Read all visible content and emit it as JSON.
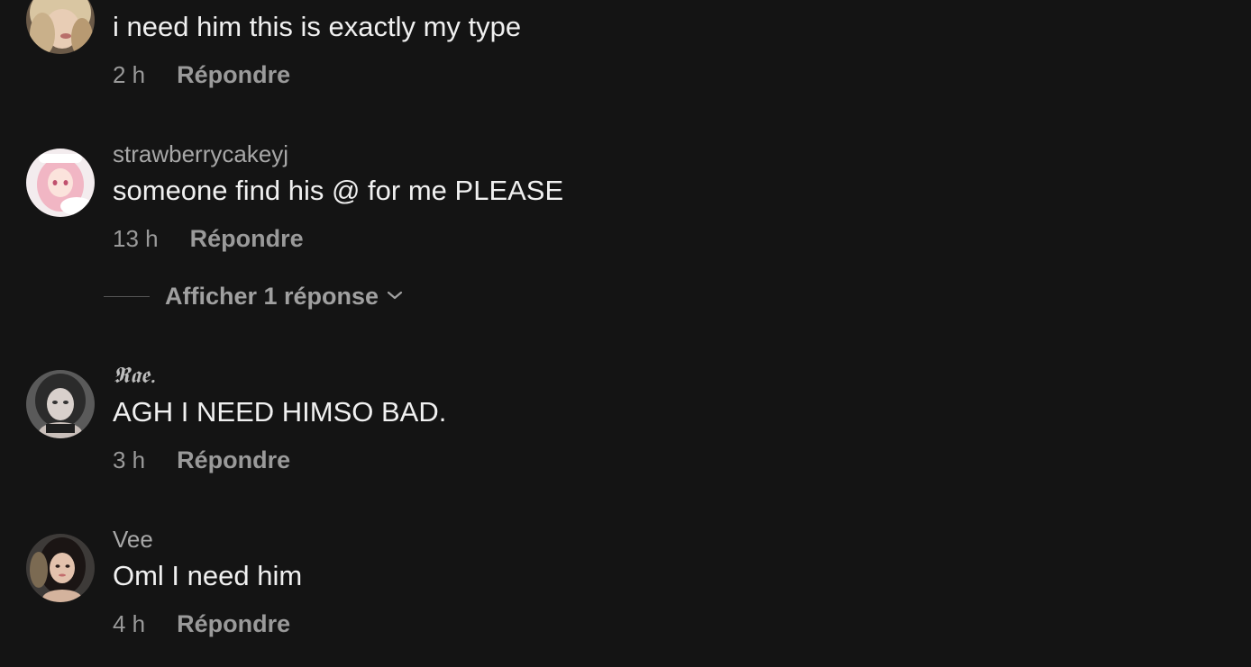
{
  "comments": [
    {
      "username": "",
      "text": "i need him this is exactly my type",
      "time": "2 h",
      "reply_label": "Répondre"
    },
    {
      "username": "strawberrycakeyj",
      "text": "someone find his @ for me PLEASE",
      "time": "13 h",
      "reply_label": "Répondre",
      "view_replies_label": "Afficher 1 réponse"
    },
    {
      "username": "𝕽𝖆𝖊.",
      "text": "AGH I NEED HIMSO BAD.",
      "time": "3 h",
      "reply_label": "Répondre"
    },
    {
      "username": "Vee",
      "text": "Oml I need him",
      "time": "4 h",
      "reply_label": "Répondre"
    }
  ],
  "colors": {
    "background": "#141414",
    "text_primary": "#f0f0f0",
    "text_secondary": "#9a9a9a"
  },
  "icons": {
    "expand": "chevron-down-icon"
  }
}
